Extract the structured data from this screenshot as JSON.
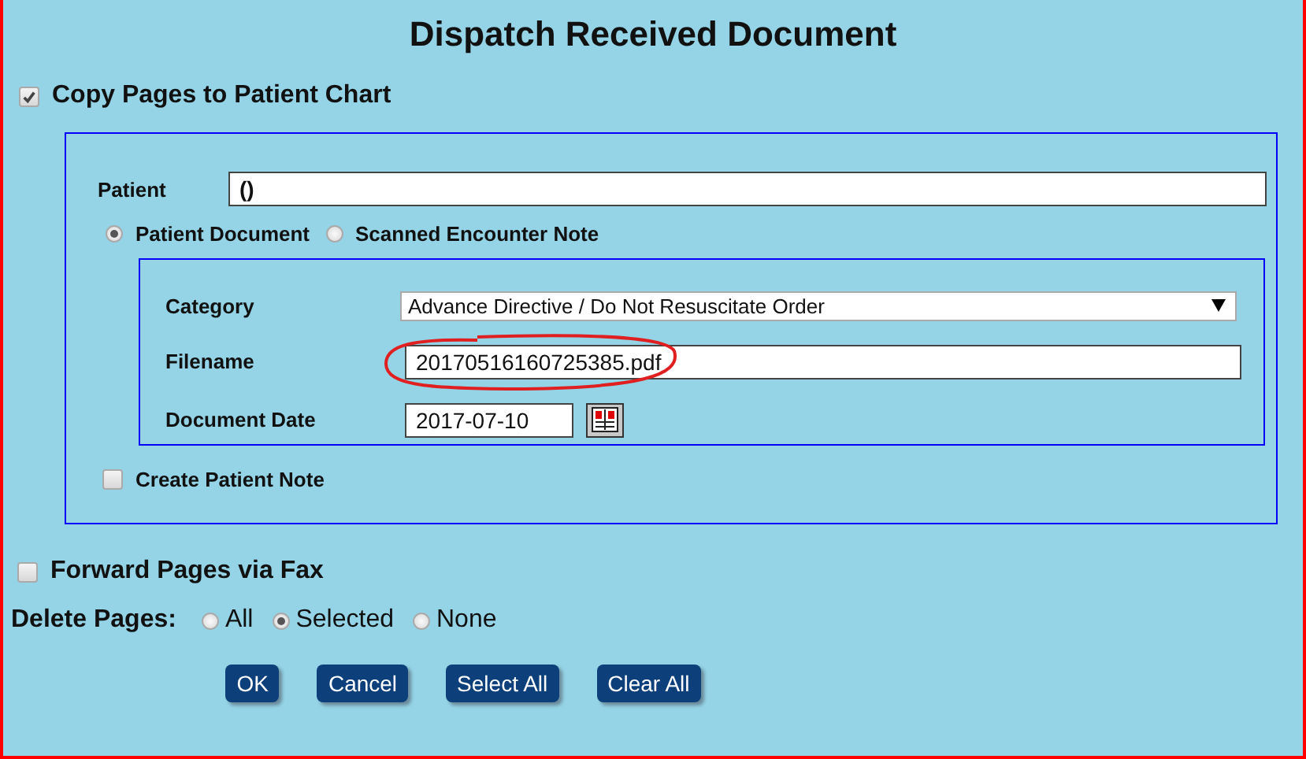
{
  "title": "Dispatch Received Document",
  "copy_pages": {
    "label": "Copy Pages to Patient Chart",
    "checked": true
  },
  "patient": {
    "label": "Patient",
    "value": "()"
  },
  "document_type": [
    {
      "label": "Patient Document",
      "selected": true
    },
    {
      "label": "Scanned Encounter Note",
      "selected": false
    }
  ],
  "category": {
    "label": "Category",
    "value": "Advance Directive / Do Not Resuscitate Order"
  },
  "filename": {
    "label": "Filename",
    "value": "20170516160725385.pdf",
    "circled": true
  },
  "document_date": {
    "label": "Document Date",
    "value": "2017-07-10"
  },
  "create_note": {
    "label": "Create Patient Note",
    "checked": false
  },
  "forward_fax": {
    "label": "Forward Pages via Fax",
    "checked": false
  },
  "delete_pages": {
    "label": "Delete Pages:",
    "options": [
      {
        "label": "All",
        "selected": false
      },
      {
        "label": "Selected",
        "selected": true
      },
      {
        "label": "None",
        "selected": false
      }
    ]
  },
  "buttons": [
    "OK",
    "Cancel",
    "Select All",
    "Clear All"
  ]
}
